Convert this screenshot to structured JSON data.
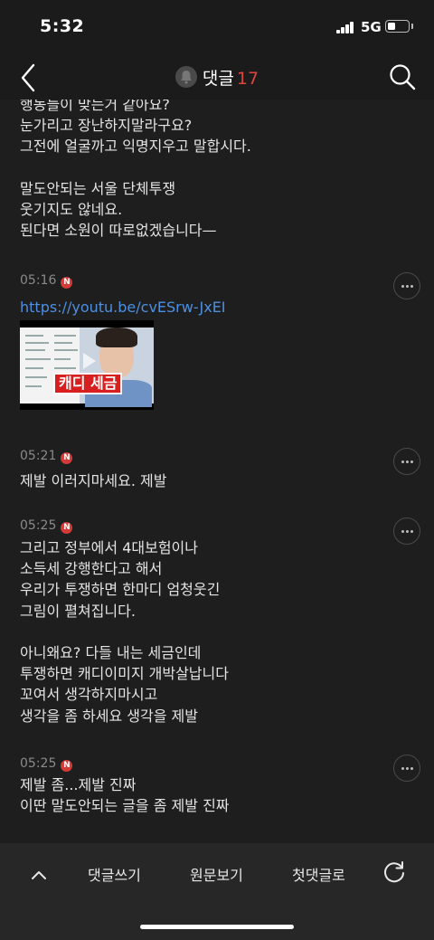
{
  "status": {
    "time": "5:32",
    "network": "5G"
  },
  "header": {
    "title": "댓글",
    "count": "17",
    "back_icon": "chevron-left-icon",
    "search_icon": "search-icon"
  },
  "comments": [
    {
      "lines": [
        "행동들이 맞는거 같아요?",
        "눈가리고 장난하지말라구요?",
        "그전에 얼굴까고 익명지우고 말합시다.",
        "",
        "말도안되는 서울 단체투쟁",
        "웃기지도 않네요.",
        "된다면 소원이 따로없겠습니다—"
      ]
    },
    {
      "time": "05:16",
      "badge": "N",
      "link": "https://youtu.be/cvESrw-JxEI",
      "thumbnail_caption": "캐디 세금"
    },
    {
      "time": "05:21",
      "badge": "N",
      "lines": [
        "제발 이러지마세요. 제발"
      ]
    },
    {
      "time": "05:25",
      "badge": "N",
      "lines": [
        "그리고 정부에서 4대보험이나",
        "소득세 강행한다고 해서",
        "우리가 투쟁하면 한마디 엄청웃긴",
        "그림이 펼쳐집니다.",
        "",
        "아니왜요? 다들 내는 세금인데",
        "투쟁하면 캐디이미지 개박살납니다",
        "꼬여서 생각하지마시고",
        "생각을 좀 하세요 생각을 제발"
      ]
    },
    {
      "time": "05:25",
      "badge": "N",
      "lines": [
        "제발 좀...제발 진짜",
        "이딴 말도안되는 글을 좀 제발 진짜"
      ]
    }
  ],
  "bottom_bar": {
    "write": "댓글쓰기",
    "original": "원문보기",
    "first": "첫댓글로"
  },
  "colors": {
    "accent_count": "#e0443e",
    "link": "#4d8fe0",
    "badge": "#d23b38",
    "background": "#1e1e1e"
  }
}
